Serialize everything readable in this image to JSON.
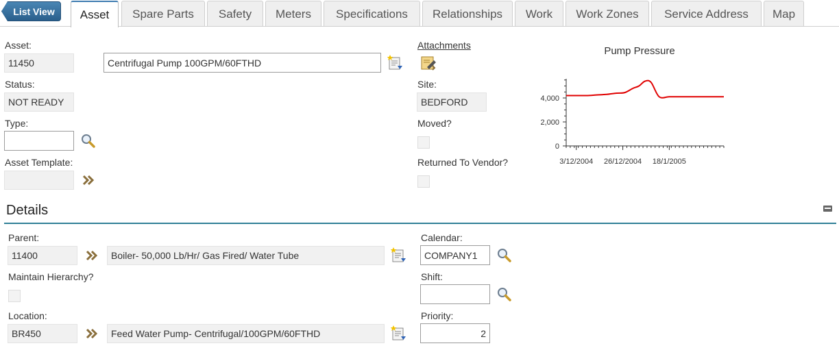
{
  "tabs": {
    "list_view": "List View",
    "items": [
      "Asset",
      "Spare Parts",
      "Safety",
      "Meters",
      "Specifications",
      "Relationships",
      "Work",
      "Work Zones",
      "Service Address",
      "Map"
    ],
    "active": "Asset"
  },
  "asset": {
    "asset_label": "Asset:",
    "asset_value": "11450",
    "description_value": "Centrifugal Pump 100GPM/60FTHD",
    "status_label": "Status:",
    "status_value": "NOT READY",
    "type_label": "Type:",
    "type_value": "",
    "template_label": "Asset Template:",
    "template_value": "",
    "attachments_label": "Attachments",
    "site_label": "Site:",
    "site_value": "BEDFORD",
    "moved_label": "Moved?",
    "moved_checked": false,
    "returned_label": "Returned To Vendor?",
    "returned_checked": false
  },
  "details": {
    "title": "Details",
    "parent_label": "Parent:",
    "parent_value": "11400",
    "parent_description": "Boiler- 50,000 Lb/Hr/ Gas Fired/ Water Tube",
    "hierarchy_label": "Maintain Hierarchy?",
    "hierarchy_checked": false,
    "location_label": "Location:",
    "location_value": "BR450",
    "location_description": "Feed Water Pump- Centrifugal/100GPM/60FTHD",
    "calendar_label": "Calendar:",
    "calendar_value": "COMPANY1",
    "shift_label": "Shift:",
    "shift_value": "",
    "priority_label": "Priority:",
    "priority_value": "2"
  },
  "colors": {
    "accent": "#2f7f96",
    "list_view_button": "#3a74a2",
    "chart_line": "#e00000"
  },
  "icons": {
    "detail_menu": "detail-menu-icon",
    "attachments": "attachments-icon",
    "lookup": "magnifier-icon",
    "go_to": "double-chevron-right-icon",
    "collapse": "collapse-section-icon"
  },
  "chart_data": {
    "type": "line",
    "title": "Pump Pressure",
    "xlabel": "",
    "ylabel": "",
    "x_ticks": [
      "3/12/2004",
      "26/12/2004",
      "18/1/2005"
    ],
    "y_ticks": [
      "0",
      "2,000",
      "4,000"
    ],
    "ylim": [
      0,
      5600
    ],
    "x": [
      "2004-11-28",
      "2004-12-03",
      "2004-12-08",
      "2004-12-13",
      "2004-12-18",
      "2004-12-23",
      "2004-12-27",
      "2004-12-31",
      "2005-01-03",
      "2005-01-06",
      "2005-01-09",
      "2005-01-13",
      "2005-01-18",
      "2005-01-25",
      "2005-02-01",
      "2005-02-08",
      "2005-02-14"
    ],
    "series": [
      {
        "values": [
          4200,
          4200,
          4200,
          4250,
          4300,
          4400,
          4450,
          4800,
          5000,
          5400,
          5300,
          4100,
          4100,
          4100,
          4100,
          4100,
          4100
        ]
      }
    ],
    "grid": false,
    "legend": "none"
  }
}
